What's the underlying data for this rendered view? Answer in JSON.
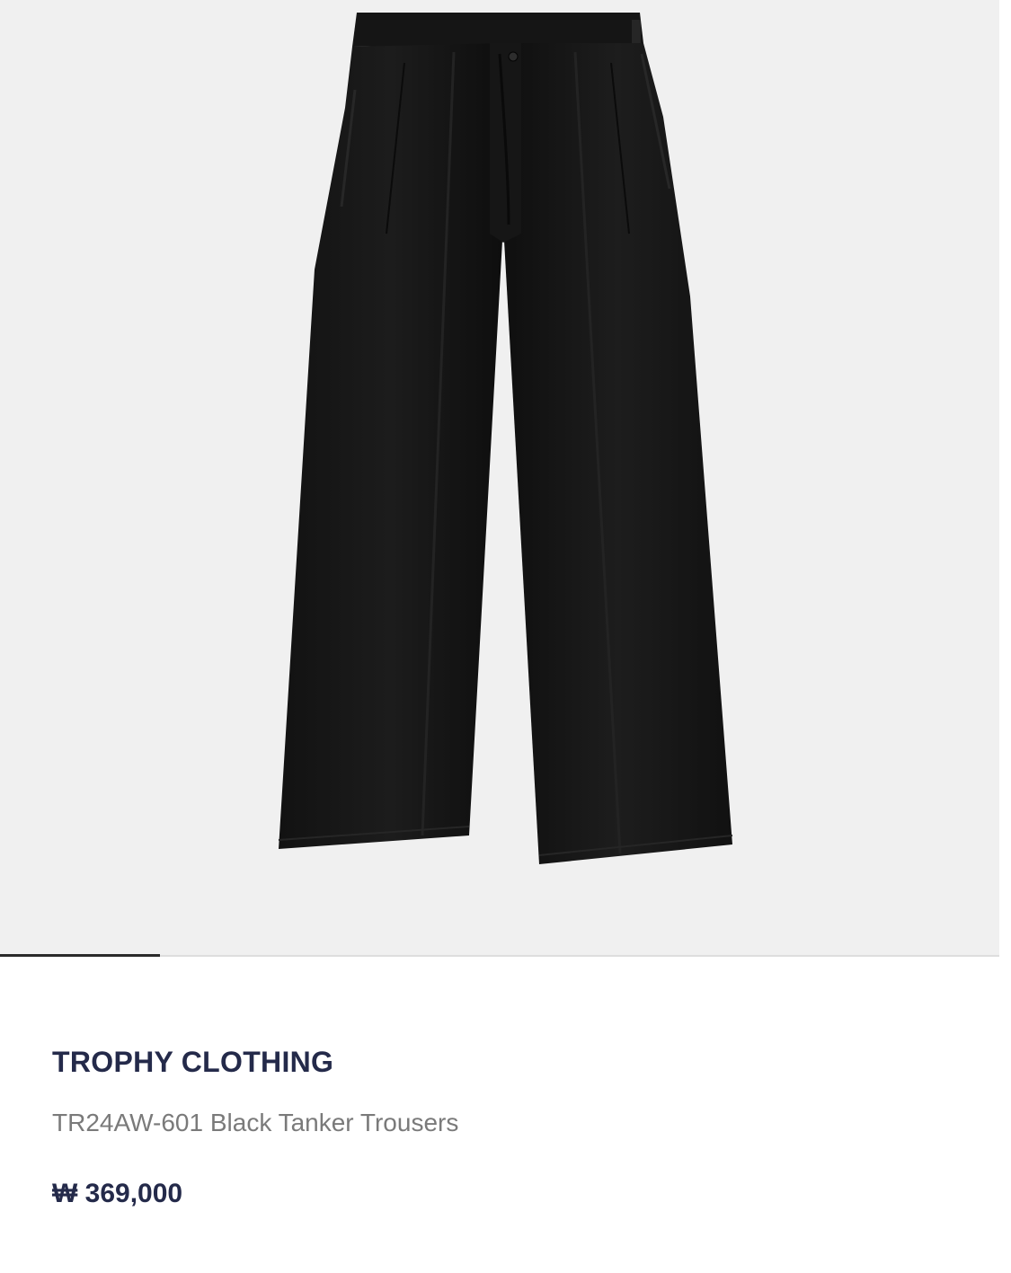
{
  "product": {
    "image_alt": "product-photo-black-trousers",
    "brand": "TROPHY CLOTHING",
    "name": "TR24AW-601 Black Tanker Trousers",
    "price": "₩ 369,000"
  },
  "carousel": {
    "progress": 0.16
  },
  "colors": {
    "image_background": "#f0f0f0",
    "garment": "#141414",
    "brand_text": "#242a4a",
    "name_text": "#7a7a7a",
    "indicator": "#2b2b2b",
    "track": "#dedede"
  }
}
